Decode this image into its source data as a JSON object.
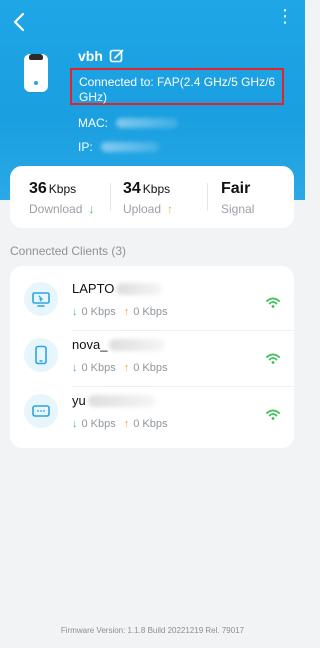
{
  "header": {
    "device_name": "vbh",
    "connected_text": "Connected to: FAP(2.4 GHz/5 GHz/6 GHz)",
    "mac_label": "MAC:",
    "ip_label": "IP:",
    "status_icons": "⋮"
  },
  "stats": {
    "download_value": "36",
    "download_unit": "Kbps",
    "download_label": "Download",
    "upload_value": "34",
    "upload_unit": "Kbps",
    "upload_label": "Upload",
    "signal_value": "Fair",
    "signal_label": "Signal",
    "down_arrow": "↓",
    "up_arrow": "↑"
  },
  "clients": {
    "title": "Connected Clients (3)",
    "items": [
      {
        "name": "LAPTO",
        "down": "0 Kbps",
        "up": "0 Kbps",
        "icon": "laptop-icon"
      },
      {
        "name": "nova_",
        "down": "0 Kbps",
        "up": "0 Kbps",
        "icon": "phone-icon"
      },
      {
        "name": "yu",
        "down": "0 Kbps",
        "up": "0 Kbps",
        "icon": "device-icon"
      }
    ]
  },
  "footer": {
    "firmware": "Firmware Version: 1.1.8 Build 20221219 Rel. 79017"
  },
  "colors": {
    "header_blue": "#1ea6e6",
    "highlight_red": "#e2232a",
    "download_green": "#42bf57",
    "upload_orange": "#f3a93a"
  }
}
